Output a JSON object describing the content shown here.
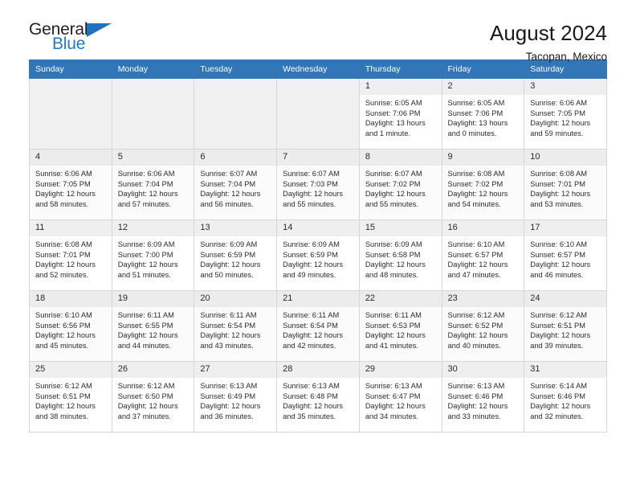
{
  "brand": {
    "name_top": "General",
    "name_bottom": "Blue",
    "triangle_color": "#1f72bd",
    "blue_text_color": "#1f7ac7"
  },
  "header": {
    "title": "August 2024",
    "subtitle": "Tacopan, Mexico"
  },
  "theme": {
    "header_bg": "#3276b8",
    "header_text": "#ffffff",
    "daynum_bg": "#efefef",
    "empty_cell_bg": "#f0f0f0",
    "grid_border": "#d7d7d7"
  },
  "weekday_headers": [
    "Sunday",
    "Monday",
    "Tuesday",
    "Wednesday",
    "Thursday",
    "Friday",
    "Saturday"
  ],
  "weeks": [
    [
      {
        "day": "",
        "lines": []
      },
      {
        "day": "",
        "lines": []
      },
      {
        "day": "",
        "lines": []
      },
      {
        "day": "",
        "lines": []
      },
      {
        "day": "1",
        "lines": [
          "Sunrise: 6:05 AM",
          "Sunset: 7:06 PM",
          "Daylight: 13 hours",
          "and 1 minute."
        ]
      },
      {
        "day": "2",
        "lines": [
          "Sunrise: 6:05 AM",
          "Sunset: 7:06 PM",
          "Daylight: 13 hours",
          "and 0 minutes."
        ]
      },
      {
        "day": "3",
        "lines": [
          "Sunrise: 6:06 AM",
          "Sunset: 7:05 PM",
          "Daylight: 12 hours",
          "and 59 minutes."
        ]
      }
    ],
    [
      {
        "day": "4",
        "lines": [
          "Sunrise: 6:06 AM",
          "Sunset: 7:05 PM",
          "Daylight: 12 hours",
          "and 58 minutes."
        ]
      },
      {
        "day": "5",
        "lines": [
          "Sunrise: 6:06 AM",
          "Sunset: 7:04 PM",
          "Daylight: 12 hours",
          "and 57 minutes."
        ]
      },
      {
        "day": "6",
        "lines": [
          "Sunrise: 6:07 AM",
          "Sunset: 7:04 PM",
          "Daylight: 12 hours",
          "and 56 minutes."
        ]
      },
      {
        "day": "7",
        "lines": [
          "Sunrise: 6:07 AM",
          "Sunset: 7:03 PM",
          "Daylight: 12 hours",
          "and 55 minutes."
        ]
      },
      {
        "day": "8",
        "lines": [
          "Sunrise: 6:07 AM",
          "Sunset: 7:02 PM",
          "Daylight: 12 hours",
          "and 55 minutes."
        ]
      },
      {
        "day": "9",
        "lines": [
          "Sunrise: 6:08 AM",
          "Sunset: 7:02 PM",
          "Daylight: 12 hours",
          "and 54 minutes."
        ]
      },
      {
        "day": "10",
        "lines": [
          "Sunrise: 6:08 AM",
          "Sunset: 7:01 PM",
          "Daylight: 12 hours",
          "and 53 minutes."
        ]
      }
    ],
    [
      {
        "day": "11",
        "lines": [
          "Sunrise: 6:08 AM",
          "Sunset: 7:01 PM",
          "Daylight: 12 hours",
          "and 52 minutes."
        ]
      },
      {
        "day": "12",
        "lines": [
          "Sunrise: 6:09 AM",
          "Sunset: 7:00 PM",
          "Daylight: 12 hours",
          "and 51 minutes."
        ]
      },
      {
        "day": "13",
        "lines": [
          "Sunrise: 6:09 AM",
          "Sunset: 6:59 PM",
          "Daylight: 12 hours",
          "and 50 minutes."
        ]
      },
      {
        "day": "14",
        "lines": [
          "Sunrise: 6:09 AM",
          "Sunset: 6:59 PM",
          "Daylight: 12 hours",
          "and 49 minutes."
        ]
      },
      {
        "day": "15",
        "lines": [
          "Sunrise: 6:09 AM",
          "Sunset: 6:58 PM",
          "Daylight: 12 hours",
          "and 48 minutes."
        ]
      },
      {
        "day": "16",
        "lines": [
          "Sunrise: 6:10 AM",
          "Sunset: 6:57 PM",
          "Daylight: 12 hours",
          "and 47 minutes."
        ]
      },
      {
        "day": "17",
        "lines": [
          "Sunrise: 6:10 AM",
          "Sunset: 6:57 PM",
          "Daylight: 12 hours",
          "and 46 minutes."
        ]
      }
    ],
    [
      {
        "day": "18",
        "lines": [
          "Sunrise: 6:10 AM",
          "Sunset: 6:56 PM",
          "Daylight: 12 hours",
          "and 45 minutes."
        ]
      },
      {
        "day": "19",
        "lines": [
          "Sunrise: 6:11 AM",
          "Sunset: 6:55 PM",
          "Daylight: 12 hours",
          "and 44 minutes."
        ]
      },
      {
        "day": "20",
        "lines": [
          "Sunrise: 6:11 AM",
          "Sunset: 6:54 PM",
          "Daylight: 12 hours",
          "and 43 minutes."
        ]
      },
      {
        "day": "21",
        "lines": [
          "Sunrise: 6:11 AM",
          "Sunset: 6:54 PM",
          "Daylight: 12 hours",
          "and 42 minutes."
        ]
      },
      {
        "day": "22",
        "lines": [
          "Sunrise: 6:11 AM",
          "Sunset: 6:53 PM",
          "Daylight: 12 hours",
          "and 41 minutes."
        ]
      },
      {
        "day": "23",
        "lines": [
          "Sunrise: 6:12 AM",
          "Sunset: 6:52 PM",
          "Daylight: 12 hours",
          "and 40 minutes."
        ]
      },
      {
        "day": "24",
        "lines": [
          "Sunrise: 6:12 AM",
          "Sunset: 6:51 PM",
          "Daylight: 12 hours",
          "and 39 minutes."
        ]
      }
    ],
    [
      {
        "day": "25",
        "lines": [
          "Sunrise: 6:12 AM",
          "Sunset: 6:51 PM",
          "Daylight: 12 hours",
          "and 38 minutes."
        ]
      },
      {
        "day": "26",
        "lines": [
          "Sunrise: 6:12 AM",
          "Sunset: 6:50 PM",
          "Daylight: 12 hours",
          "and 37 minutes."
        ]
      },
      {
        "day": "27",
        "lines": [
          "Sunrise: 6:13 AM",
          "Sunset: 6:49 PM",
          "Daylight: 12 hours",
          "and 36 minutes."
        ]
      },
      {
        "day": "28",
        "lines": [
          "Sunrise: 6:13 AM",
          "Sunset: 6:48 PM",
          "Daylight: 12 hours",
          "and 35 minutes."
        ]
      },
      {
        "day": "29",
        "lines": [
          "Sunrise: 6:13 AM",
          "Sunset: 6:47 PM",
          "Daylight: 12 hours",
          "and 34 minutes."
        ]
      },
      {
        "day": "30",
        "lines": [
          "Sunrise: 6:13 AM",
          "Sunset: 6:46 PM",
          "Daylight: 12 hours",
          "and 33 minutes."
        ]
      },
      {
        "day": "31",
        "lines": [
          "Sunrise: 6:14 AM",
          "Sunset: 6:46 PM",
          "Daylight: 12 hours",
          "and 32 minutes."
        ]
      }
    ]
  ]
}
